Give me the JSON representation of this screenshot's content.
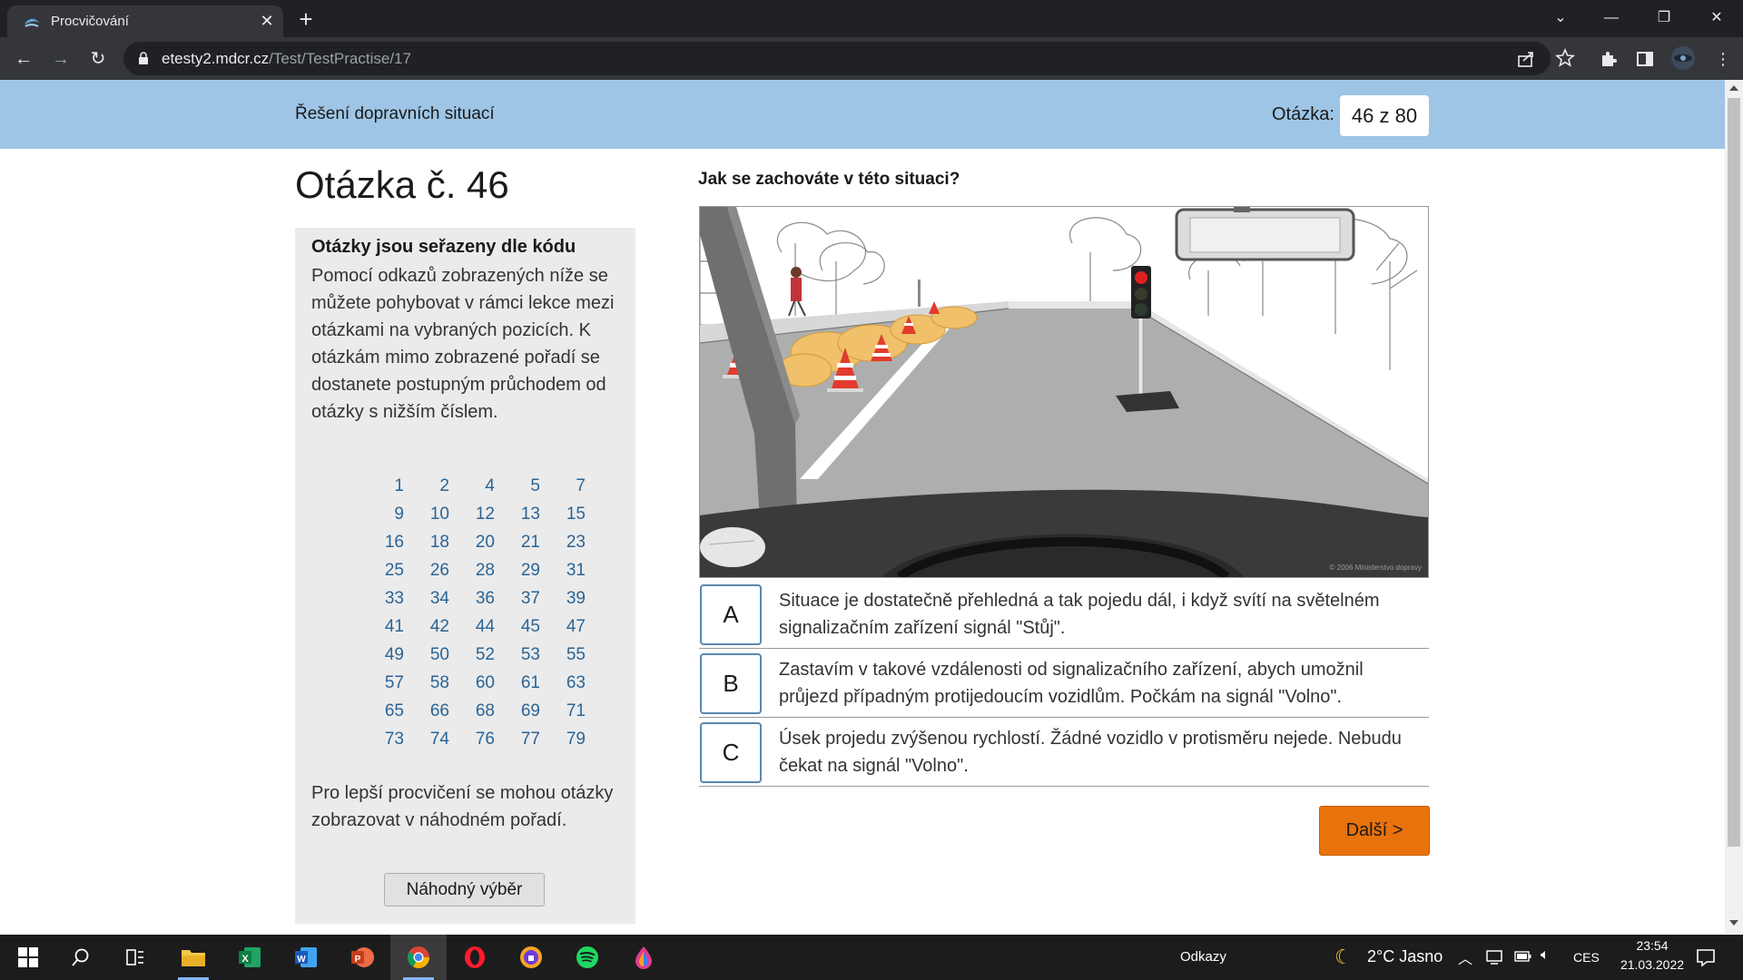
{
  "browser": {
    "tab_title": "Procvičování",
    "url_host": "etesty2.mdcr.cz",
    "url_path": "/Test/TestPractise/17"
  },
  "header": {
    "section_title": "Řešení dopravních situací",
    "counter_label": "Otázka:",
    "counter_value": "46 z 80"
  },
  "left": {
    "heading": "Otázka č. 46",
    "panel_title": "Otázky jsou seřazeny dle kódu",
    "panel_text": "Pomocí odkazů zobrazených níže se můžete pohybovat v rámci lekce mezi otázkami na vybraných pozicích. K otázkám mimo zobrazené pořadí se dostanete postupným průchodem od otázky s nižším číslem.",
    "question_links": [
      [
        "1",
        "2",
        "4",
        "5",
        "7"
      ],
      [
        "9",
        "10",
        "12",
        "13",
        "15"
      ],
      [
        "16",
        "18",
        "20",
        "21",
        "23"
      ],
      [
        "25",
        "26",
        "28",
        "29",
        "31"
      ],
      [
        "33",
        "34",
        "36",
        "37",
        "39"
      ],
      [
        "41",
        "42",
        "44",
        "45",
        "47"
      ],
      [
        "49",
        "50",
        "52",
        "53",
        "55"
      ],
      [
        "57",
        "58",
        "60",
        "61",
        "63"
      ],
      [
        "65",
        "66",
        "68",
        "69",
        "71"
      ],
      [
        "73",
        "74",
        "76",
        "77",
        "79"
      ]
    ],
    "panel_text2": "Pro lepší procvičení se mohou otázky zobrazovat v náhodném pořadí.",
    "random_button": "Náhodný výběr"
  },
  "question": {
    "text": "Jak se zachováte v této situaci?",
    "image_credit": "© 2006 Ministerstvo dopravy",
    "answers": [
      {
        "letter": "A",
        "text": "Situace je dostatečně přehledná a tak pojedu dál, i když svítí na světelném signalizačním zařízení signál \"Stůj\"."
      },
      {
        "letter": "B",
        "text": "Zastavím v takové vzdálenosti od signalizačního zařízení, abych umožnil průjezd případným protijedoucím vozidlům. Počkám na signál \"Volno\"."
      },
      {
        "letter": "C",
        "text": "Úsek projedu zvýšenou rychlostí. Žádné vozidlo v protisměru nejede. Nebudu čekat na signál \"Volno\"."
      }
    ],
    "next_button": "Další >"
  },
  "taskbar": {
    "links_label": "Odkazy",
    "weather": "2°C  Jasno",
    "language": "CES",
    "time": "23:54",
    "date": "21.03.2022"
  },
  "colors": {
    "header_bg": "#9ec5e5",
    "next_button": "#e8720c",
    "answer_border": "#5b87ad",
    "link": "#2a6496"
  }
}
